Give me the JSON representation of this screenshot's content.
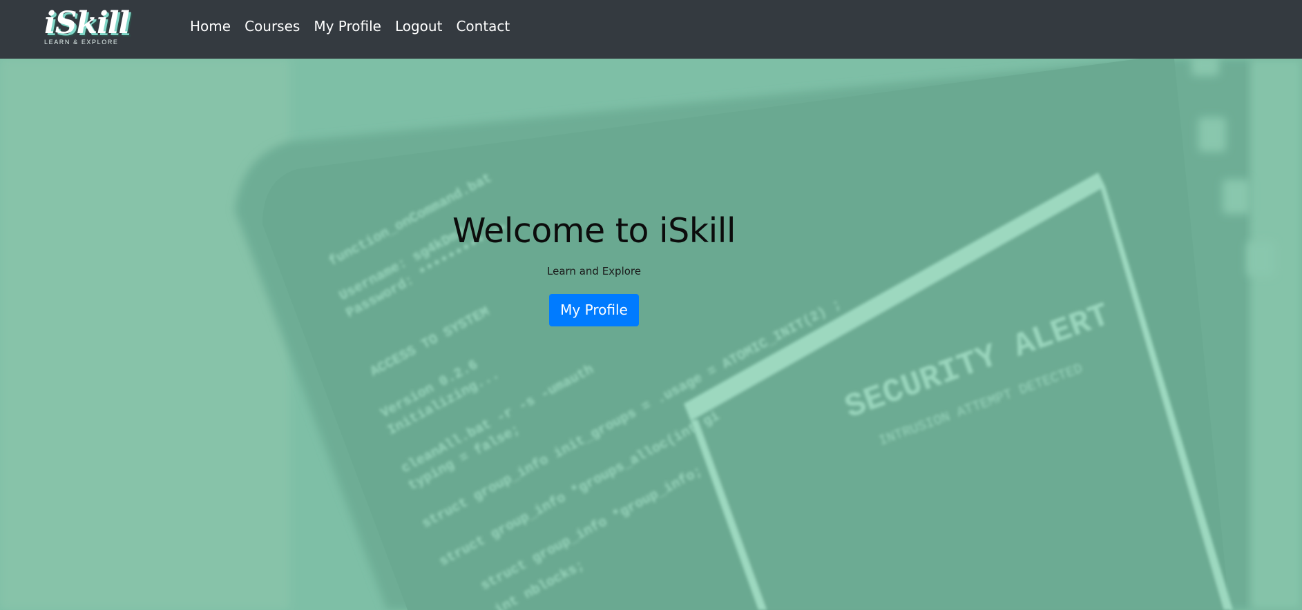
{
  "brand": {
    "logo_text": "iSkill",
    "tagline": "LEARN & EXPLORE"
  },
  "nav": {
    "items": [
      {
        "label": "Home"
      },
      {
        "label": "Courses"
      },
      {
        "label": "My Profile"
      },
      {
        "label": "Logout"
      },
      {
        "label": "Contact"
      }
    ]
  },
  "hero": {
    "title": "Welcome to iSkill",
    "subtitle": "Learn and Explore",
    "button_label": "My Profile",
    "background_image": "blurred-code-monitor-security-alert",
    "background_text": {
      "security_alert": "SECURITY ALERT",
      "alert_subtext": "INTRUSION ATTEMPT DETECTED",
      "code_lines": [
        "function_onCommand.bat",
        "Username: sg4kDm3",
        "Password: ************",
        "ACCESS TO SYSTEM",
        "Version 0.2.6",
        "Initializing...",
        "cleanAll.bat -r -s -umauth",
        "typing = false;",
        "struct group_info init_groups = .usage = ATOMIC_INIT(2) ;",
        "struct group_info *groups_alloc(int gi",
        "struct group_info *group_info;",
        "int nblocks;"
      ]
    }
  },
  "colors": {
    "navbar": "#343a40",
    "hero_overlay": "#74b59d",
    "button": "#007bff"
  }
}
